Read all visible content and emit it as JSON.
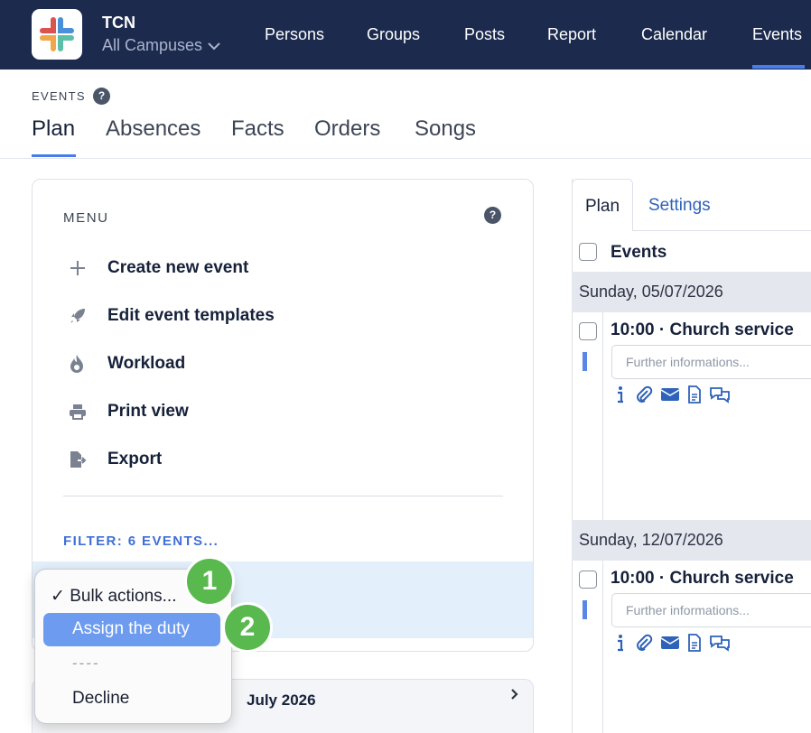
{
  "org": {
    "name": "TCN",
    "campus": "All Campuses"
  },
  "nav": [
    "Persons",
    "Groups",
    "Posts",
    "Report",
    "Calendar",
    "Events"
  ],
  "section": {
    "label": "EVENTS",
    "help": "?"
  },
  "subtabs": [
    "Plan",
    "Absences",
    "Facts",
    "Orders",
    "Songs"
  ],
  "menu": {
    "title": "MENU",
    "help": "?",
    "items": [
      {
        "label": "Create new event",
        "icon": "plus-icon"
      },
      {
        "label": "Edit event templates",
        "icon": "rocket-icon"
      },
      {
        "label": "Workload",
        "icon": "flame-icon"
      },
      {
        "label": "Print view",
        "icon": "printer-icon"
      },
      {
        "label": "Export",
        "icon": "file-export-icon"
      }
    ],
    "filter": "FILTER: 6 EVENTS..."
  },
  "bulk_dropdown": {
    "selected": "Bulk actions...",
    "check": "✓",
    "options": [
      "Assign the duty",
      "----",
      "Decline"
    ]
  },
  "month": {
    "label": "July 2026"
  },
  "right_pane": {
    "tabs": [
      "Plan",
      "Settings"
    ],
    "events_header": "Events",
    "days": [
      {
        "date": "Sunday, 05/07/2026",
        "event": "10:00 · Church service",
        "placeholder": "Further informations..."
      },
      {
        "date": "Sunday, 12/07/2026",
        "event": "10:00 · Church service",
        "placeholder": "Further informations..."
      }
    ],
    "action_icons": [
      "info-icon",
      "paperclip-icon",
      "envelope-icon",
      "document-icon",
      "comments-icon"
    ]
  },
  "badges": [
    "1",
    "2"
  ],
  "colors": {
    "topbar": "#1c2a4e",
    "accent": "#4a7bea",
    "highlight": "#6c9bf0",
    "badge": "#59b94f",
    "bulk_band": "#e3effa"
  }
}
